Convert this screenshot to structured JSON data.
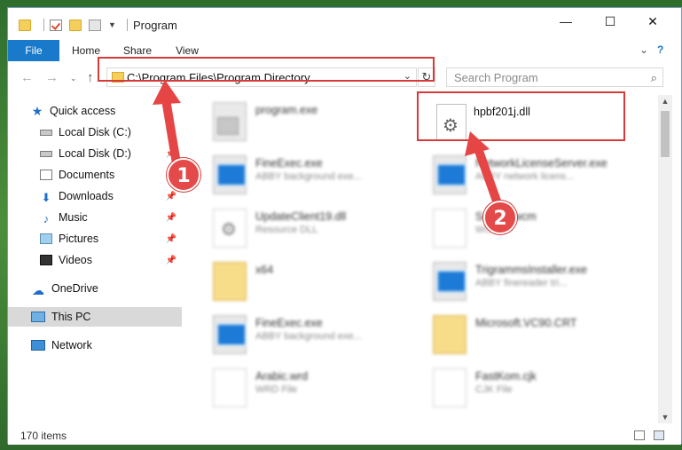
{
  "window": {
    "title": "Program"
  },
  "ribbon": {
    "tabs": [
      {
        "label": "File"
      },
      {
        "label": "Home"
      },
      {
        "label": "Share"
      },
      {
        "label": "View"
      }
    ]
  },
  "address": {
    "path": "C:\\Program Files\\Program Directory",
    "search_placeholder": "Search Program"
  },
  "sidebar": {
    "items": [
      {
        "label": "Quick access",
        "icon": "star-icon",
        "pinned": false
      },
      {
        "label": "Local Disk (C:)",
        "icon": "drive-icon",
        "pinned": false
      },
      {
        "label": "Local Disk (D:)",
        "icon": "drive-icon",
        "pinned": true
      },
      {
        "label": "Documents",
        "icon": "documents-icon",
        "pinned": true
      },
      {
        "label": "Downloads",
        "icon": "downloads-icon",
        "pinned": true
      },
      {
        "label": "Music",
        "icon": "music-icon",
        "pinned": true
      },
      {
        "label": "Pictures",
        "icon": "pictures-icon",
        "pinned": true
      },
      {
        "label": "Videos",
        "icon": "videos-icon",
        "pinned": true
      },
      {
        "label": "OneDrive",
        "icon": "cloud-icon",
        "pinned": false
      },
      {
        "label": "This PC",
        "icon": "computer-icon",
        "pinned": false,
        "selected": true
      },
      {
        "label": "Network",
        "icon": "network-icon",
        "pinned": false
      }
    ]
  },
  "files": [
    {
      "name": "program.exe",
      "sub": "",
      "type": "setup"
    },
    {
      "name": "hpbf201j.dll",
      "sub": "",
      "type": "dll",
      "highlighted": true
    },
    {
      "name": "FineExec.exe",
      "sub": "ABBY background exe...",
      "type": "exe"
    },
    {
      "name": "NetworkLicenseServer.exe",
      "sub": "ABBY network licens...",
      "type": "exe"
    },
    {
      "name": "UpdateClient19.dll",
      "sub": "Resource DLL",
      "type": "dll"
    },
    {
      "name": "Sn...10.wcm",
      "sub": "WC...",
      "type": "generic"
    },
    {
      "name": "x64",
      "sub": "",
      "type": "folder"
    },
    {
      "name": "TrigrammsInstaller.exe",
      "sub": "ABBY finereader tri...",
      "type": "exe"
    },
    {
      "name": "FineExec.exe",
      "sub": "ABBY background exe...",
      "type": "exe"
    },
    {
      "name": "Microsoft.VC90.CRT",
      "sub": "",
      "type": "folder"
    },
    {
      "name": "Arabic.wrd",
      "sub": "WRD File",
      "type": "generic"
    },
    {
      "name": "FastKom.cjk",
      "sub": "CJK File",
      "type": "generic"
    }
  ],
  "status": {
    "item_count": "170 items"
  },
  "callouts": {
    "one": "1",
    "two": "2"
  }
}
